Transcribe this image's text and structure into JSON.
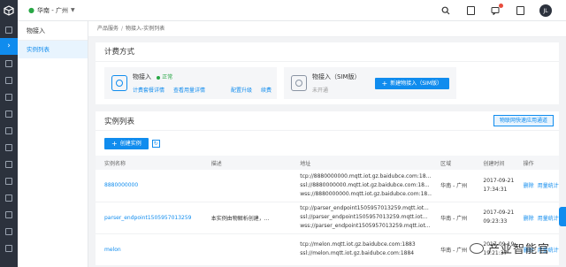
{
  "topbar": {
    "region": "华南 - 广州",
    "avatar_text": "JL"
  },
  "subnav": {
    "title": "物接入",
    "items": [
      {
        "label": "实例列表"
      }
    ]
  },
  "breadcrumb": {
    "root": "产品服务",
    "current": "物接入-实例列表"
  },
  "billing": {
    "title": "计费方式",
    "plan_a": {
      "name": "物接入",
      "status": "正常",
      "links": [
        "计费套餐详情",
        "查看用量详情"
      ],
      "right_links": [
        "配置升级",
        "续费"
      ]
    },
    "plan_b": {
      "name": "物接入（SIM版）",
      "status": "未开通",
      "button": "新建物接入（SIM版）"
    }
  },
  "instances": {
    "title": "实例列表",
    "quick_channel": "物联网快速应用通道",
    "create_button": "创建实例",
    "refresh_icon": "refresh-icon",
    "columns": [
      "实例名称",
      "描述",
      "地址",
      "区域",
      "创建时间",
      "操作"
    ],
    "rows": [
      {
        "name": "8880000000",
        "desc": "",
        "addr": [
          "tcp://8880000000.mqtt.iot.gz.baidubce.com:18...",
          "ssl://8880000000.mqtt.iot.gz.baidubce.com:18...",
          "wss://8880000000.mqtt.iot.gz.baidubce.com:18..."
        ],
        "region": "华南 - 广州",
        "date": "2017-09-21",
        "time": "17:34:31",
        "ops": [
          "删除",
          "用量统计"
        ]
      },
      {
        "name": "parser_endpoint1505957013259",
        "desc": "本实例由物解析创建，...",
        "addr": [
          "tcp://parser_endpoint1505957013259.mqtt.iot...",
          "ssl://parser_endpoint1505957013259.mqtt.iot...",
          "wss://parser_endpoint1505957013259.mqtt.iot..."
        ],
        "region": "华南 - 广州",
        "date": "2017-09-21",
        "time": "09:23:33",
        "ops": [
          "删除",
          "用量统计"
        ]
      },
      {
        "name": "melon",
        "desc": "",
        "addr": [
          "tcp://melon.mqtt.iot.gz.baidubce.com:1883",
          "ssl://melon.mqtt.iot.gz.baidubce.com:1884"
        ],
        "region": "华南 - 广州",
        "date": "2017-09-19",
        "time": "19:21:37",
        "ops": [
          "删除",
          "用量统计"
        ]
      }
    ]
  },
  "watermark": {
    "text": "产业智能官"
  }
}
